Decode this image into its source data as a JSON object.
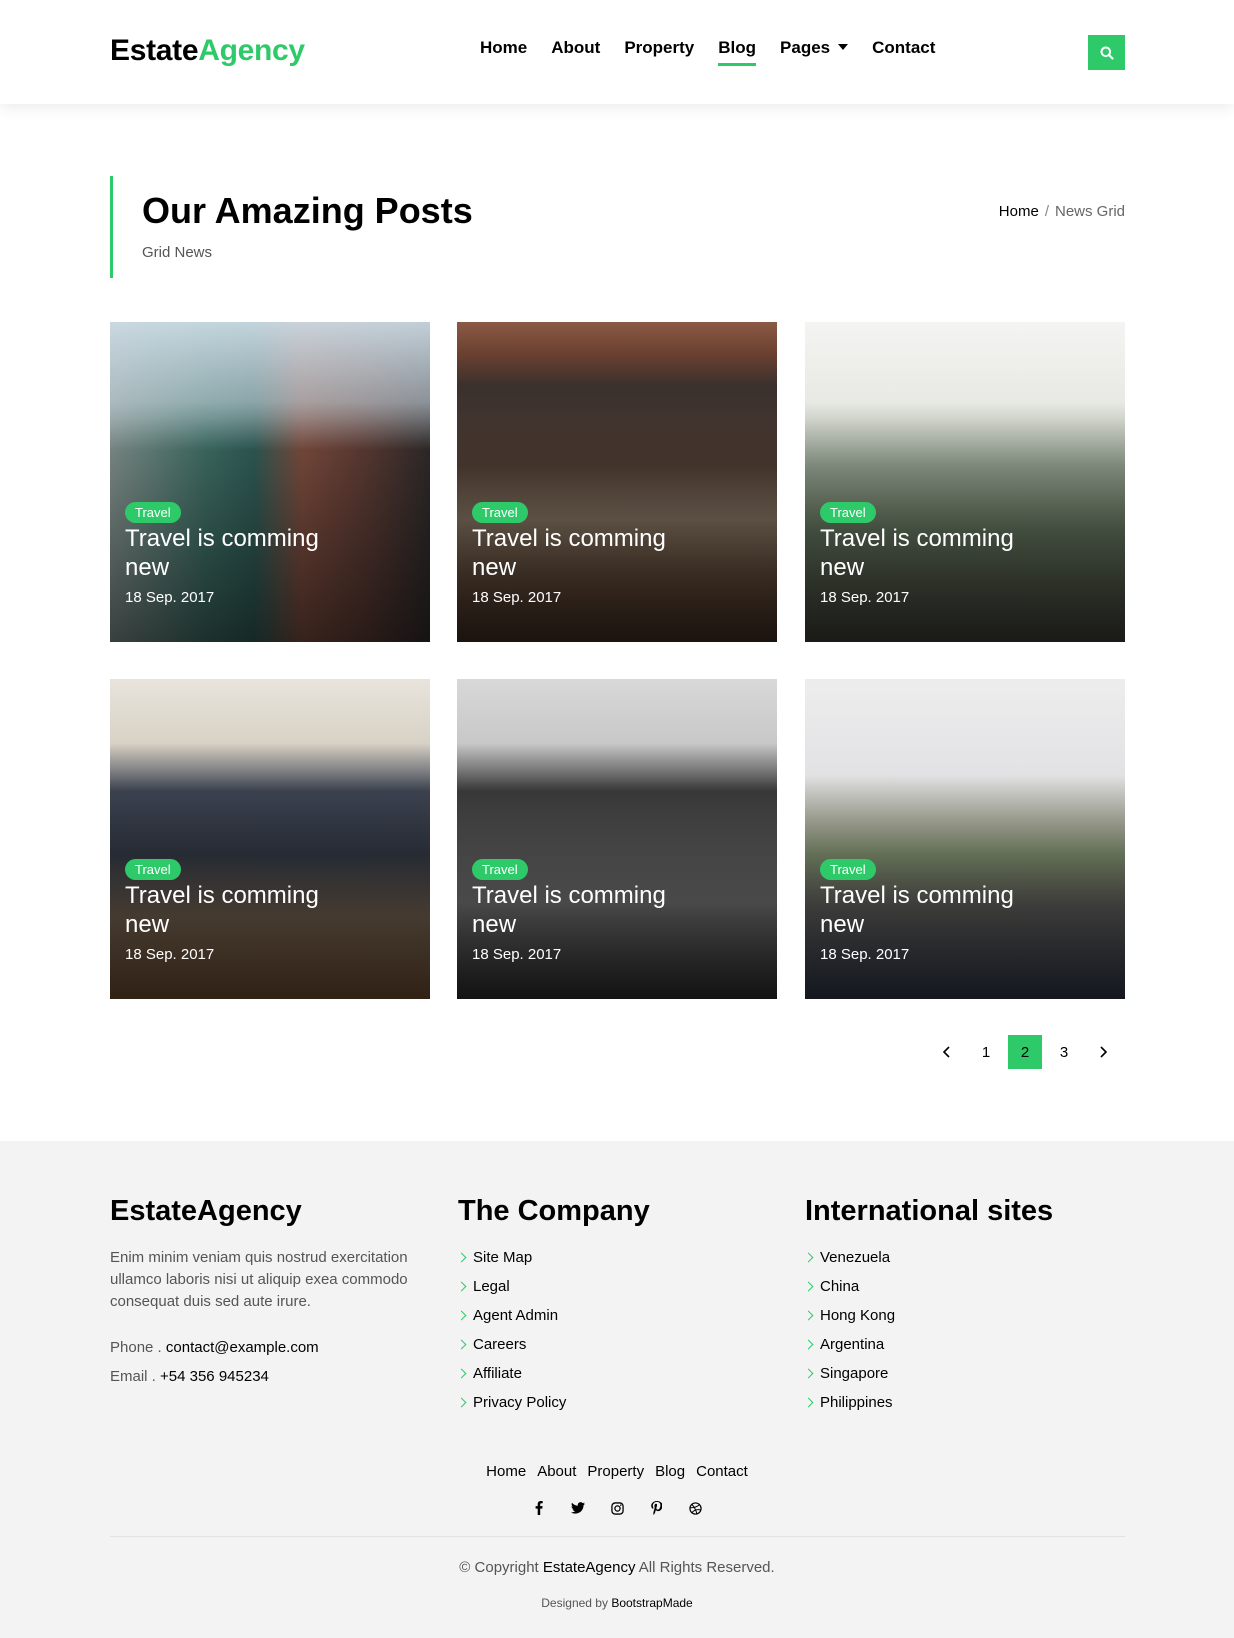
{
  "header": {
    "logo_main": "Estate",
    "logo_accent": "Agency",
    "nav": [
      "Home",
      "About",
      "Property",
      "Blog",
      "Pages",
      "Contact"
    ],
    "active_nav": "Blog",
    "search_icon": "search-icon"
  },
  "intro": {
    "title": "Our Amazing Posts",
    "subtitle": "Grid News",
    "breadcrumb_home": "Home",
    "breadcrumb_sep": "/",
    "breadcrumb_current": "News Grid"
  },
  "posts": [
    {
      "badge": "Travel",
      "title": "Travel is comming new",
      "date": "18 Sep. 2017"
    },
    {
      "badge": "Travel",
      "title": "Travel is comming new",
      "date": "18 Sep. 2017"
    },
    {
      "badge": "Travel",
      "title": "Travel is comming new",
      "date": "18 Sep. 2017"
    },
    {
      "badge": "Travel",
      "title": "Travel is comming new",
      "date": "18 Sep. 2017"
    },
    {
      "badge": "Travel",
      "title": "Travel is comming new",
      "date": "18 Sep. 2017"
    },
    {
      "badge": "Travel",
      "title": "Travel is comming new",
      "date": "18 Sep. 2017"
    }
  ],
  "pagination": {
    "pages": [
      "1",
      "2",
      "3"
    ],
    "current": "2"
  },
  "footer": {
    "brand_heading": "EstateAgency",
    "description": "Enim minim veniam quis nostrud exercitation ullamco laboris nisi ut aliquip exea commodo consequat duis sed aute irure.",
    "phone_label": "Phone .",
    "phone_value": "contact@example.com",
    "email_label": "Email .",
    "email_value": "+54 356 945234",
    "company_heading": "The Company",
    "company_links": [
      "Site Map",
      "Legal",
      "Agent Admin",
      "Careers",
      "Affiliate",
      "Privacy Policy"
    ],
    "intl_heading": "International sites",
    "intl_links": [
      "Venezuela",
      "China",
      "Hong Kong",
      "Argentina",
      "Singapore",
      "Philippines"
    ],
    "bottom_nav": [
      "Home",
      "About",
      "Property",
      "Blog",
      "Contact"
    ],
    "social_icons": [
      "facebook-icon",
      "twitter-icon",
      "instagram-icon",
      "pinterest-icon",
      "dribbble-icon"
    ],
    "copyright_prefix": "© Copyright",
    "copyright_brand": "EstateAgency",
    "copyright_suffix": "All Rights Reserved.",
    "designed_by": "Designed by",
    "designer": "BootstrapMade"
  },
  "colors": {
    "accent": "#2eca6a",
    "footer_bg": "#f3f3f3"
  }
}
